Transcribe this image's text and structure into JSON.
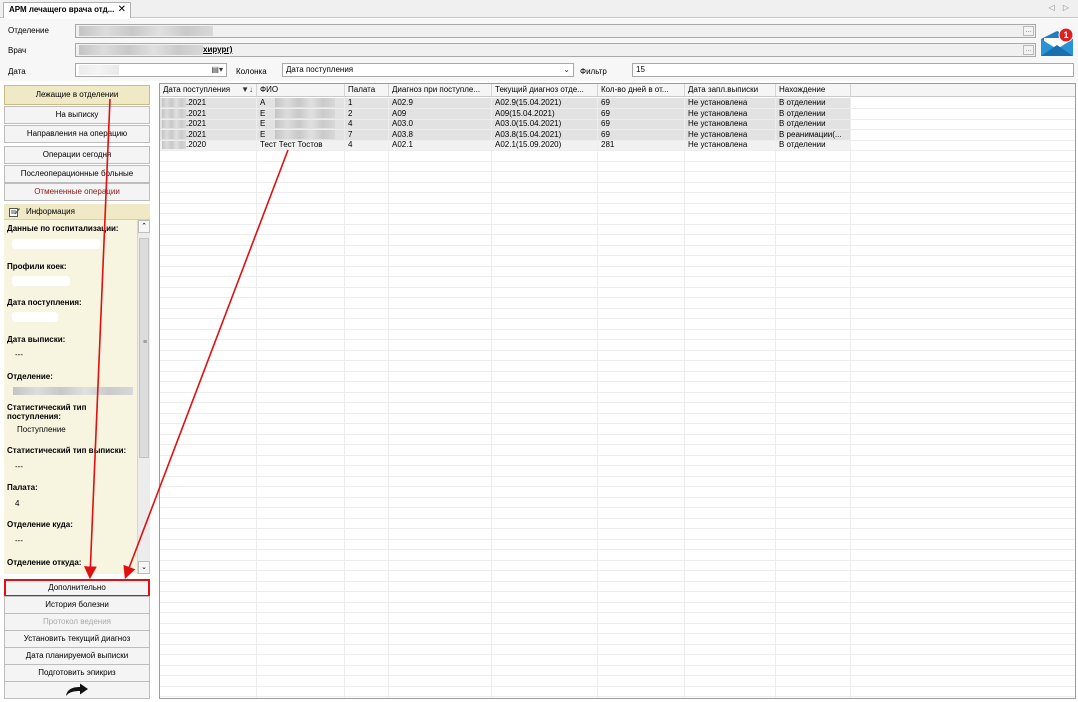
{
  "tab": {
    "title": "АРМ лечащего врача отд...",
    "close": "✕",
    "nav": "◁ ▷"
  },
  "form": {
    "department_label": "Отделение",
    "doctor_label": "Врач",
    "doctor_value_suffix": "хирург)",
    "date_label": "Дата",
    "column_label": "Колонка",
    "column_value": "Дата поступления",
    "filter_label": "Фильтр",
    "filter_value": "15",
    "ellipsis": "..."
  },
  "notifications": {
    "count": "1"
  },
  "nav": {
    "in_department": "Лежащие в отделении",
    "to_discharge": "На выписку",
    "surgery_referrals": "Направления на операцию",
    "surgeries_today": "Операции сегодня",
    "postop_patients": "Послеоперационные больные",
    "cancelled_surgeries": "Отмененные операции"
  },
  "info": {
    "header": "Информация",
    "hospitalization_data": "Данные по госпитализации:",
    "bed_profiles": "Профили коек:",
    "admission_date": "Дата поступления:",
    "discharge_date": "Дата выписки:",
    "discharge_date_value": "---",
    "department": "Отделение:",
    "stat_admission_type": "Статистический тип поступления:",
    "stat_admission_type_value": "Поступление",
    "stat_discharge_type": "Статистический тип выписки:",
    "stat_discharge_type_value": "---",
    "ward": "Палата:",
    "ward_value": "4",
    "dept_to": "Отделение куда:",
    "dept_to_value": "---",
    "dept_from": "Отделение откуда:"
  },
  "actions": {
    "additional": "Дополнительно",
    "history": "История болезни",
    "protocol": "Протокол ведения",
    "set_diagnosis": "Установить текущий диагноз",
    "planned_discharge": "Дата планируемой выписки",
    "epicrisis": "Подготовить эпикриз",
    "forward_icon": "forward-arrow-icon"
  },
  "table": {
    "columns": [
      "Дата поступления",
      "ФИО",
      "Палата",
      "Диагноз при поступле...",
      "Текущий диагноз отде...",
      "Кол-во дней в от...",
      "Дата запл.выписки",
      "Нахождение"
    ],
    "rows": [
      [
        ".2021",
        "А",
        "1",
        "A02.9",
        "A02.9(15.04.2021)",
        "69",
        "Не установлена",
        "В отделении"
      ],
      [
        ".2021",
        "Е",
        "2",
        "A09",
        "A09(15.04.2021)",
        "69",
        "Не установлена",
        "В отделении"
      ],
      [
        ".2021",
        "Е",
        "4",
        "A03.0",
        "A03.0(15.04.2021)",
        "69",
        "Не установлена",
        "В отделении"
      ],
      [
        ".2021",
        "Е",
        "7",
        "A03.8",
        "A03.8(15.04.2021)",
        "69",
        "Не установлена",
        "В реанимации(..."
      ],
      [
        ".2020",
        "Тест Тест Тостов",
        "4",
        "A02.1",
        "A02.1(15.09.2020)",
        "281",
        "Не установлена",
        "В отделении"
      ]
    ]
  },
  "colors": {
    "accent_panel": "#efe9c5",
    "annotation": "#e01010",
    "selection": "#e2e2e2"
  }
}
